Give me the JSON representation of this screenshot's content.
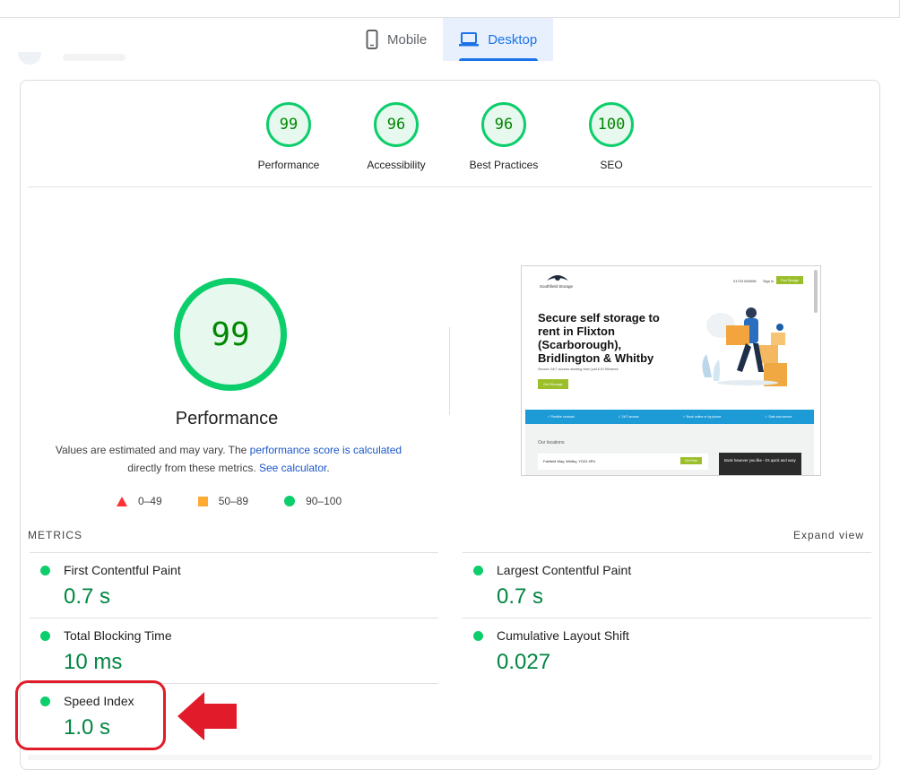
{
  "tabs": [
    {
      "label": "Mobile",
      "icon": "mobile-icon",
      "active": false
    },
    {
      "label": "Desktop",
      "icon": "laptop-icon",
      "active": true
    }
  ],
  "category_scores": [
    {
      "score": "99",
      "label": "Performance"
    },
    {
      "score": "96",
      "label": "Accessibility"
    },
    {
      "score": "96",
      "label": "Best Practices"
    },
    {
      "score": "100",
      "label": "SEO"
    }
  ],
  "performance": {
    "score": "99",
    "title": "Performance",
    "note_prefix": "Values are estimated and may vary. The ",
    "note_link1": "performance score is calculated",
    "note_middle": " directly from these metrics. ",
    "note_link2": "See calculator",
    "note_suffix": "."
  },
  "legend": [
    {
      "range": "0–49",
      "shape": "triangle",
      "color": "#ff3333"
    },
    {
      "range": "50–89",
      "shape": "square",
      "color": "#ffaa33"
    },
    {
      "range": "90–100",
      "shape": "circle",
      "color": "#0cce6b"
    }
  ],
  "screenshot": {
    "logo_text": "Southfield Storage",
    "phone": "01723 600096",
    "signin": "Sign in",
    "cta": "Find Storage",
    "headline_lines": [
      "Secure self storage to",
      "rent in Flixton",
      "(Scarborough),",
      "Bridlington & Whitby"
    ],
    "subtext": "Secure 24/7 access starting from just £19.99/week",
    "button": "Get Storage",
    "features": [
      "✓ Flexible contract",
      "✓ 24/7 access",
      "✓ Book online or by phone",
      "✓ Safe and secure"
    ],
    "locations_heading": "Our locations",
    "location": "Fairfield Way, Whitby, YO22 4PU",
    "location_button": "Get Price",
    "promo": "Book however you like - it's quick and easy"
  },
  "metrics_section": {
    "label": "METRICS",
    "expand": "Expand view"
  },
  "metrics": [
    {
      "name": "First Contentful Paint",
      "value": "0.7 s"
    },
    {
      "name": "Largest Contentful Paint",
      "value": "0.7 s"
    },
    {
      "name": "Total Blocking Time",
      "value": "10 ms"
    },
    {
      "name": "Cumulative Layout Shift",
      "value": "0.027"
    },
    {
      "name": "Speed Index",
      "value": "1.0 s"
    }
  ],
  "colors": {
    "pass": "#0cce6b",
    "pass_text": "#018642",
    "accent": "#1a73e8",
    "annotation": "#e21b2a"
  }
}
